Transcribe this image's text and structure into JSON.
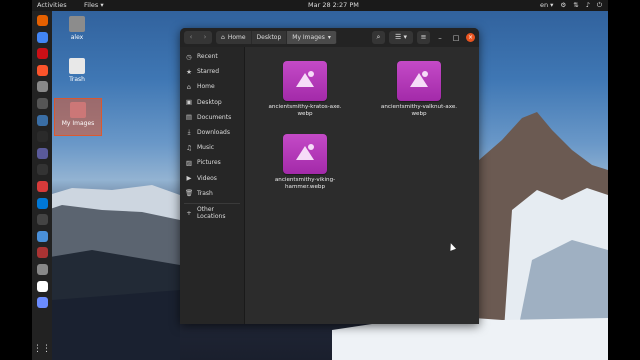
{
  "topbar": {
    "activities": "Activities",
    "app_menu": "Files ▾",
    "clock": "Mar 28  2:27 PM",
    "lang": "en ▾"
  },
  "desktop": {
    "icons": [
      {
        "label": "alex",
        "icon": "home-folder-icon"
      },
      {
        "label": "Trash",
        "icon": "trash-icon"
      },
      {
        "label": "My Images",
        "icon": "folder-icon"
      }
    ]
  },
  "window": {
    "breadcrumbs": [
      "Home",
      "Desktop",
      "My Images"
    ],
    "sidebar": {
      "items": [
        {
          "label": "Recent",
          "icon": "clock-icon"
        },
        {
          "label": "Starred",
          "icon": "star-icon"
        },
        {
          "label": "Home",
          "icon": "home-icon"
        },
        {
          "label": "Desktop",
          "icon": "desktop-icon"
        },
        {
          "label": "Documents",
          "icon": "document-icon"
        },
        {
          "label": "Downloads",
          "icon": "download-icon"
        },
        {
          "label": "Music",
          "icon": "music-icon"
        },
        {
          "label": "Pictures",
          "icon": "pictures-icon"
        },
        {
          "label": "Videos",
          "icon": "videos-icon"
        },
        {
          "label": "Trash",
          "icon": "trash-icon"
        }
      ],
      "other": "Other Locations"
    },
    "files": [
      {
        "name": "ancientsmithy-kratos-axe.\nwebp"
      },
      {
        "name": "ancientsmithy-valknut-axe.\nwebp"
      },
      {
        "name": "ancientsmithy-viking-\nhammer.webp"
      }
    ]
  }
}
